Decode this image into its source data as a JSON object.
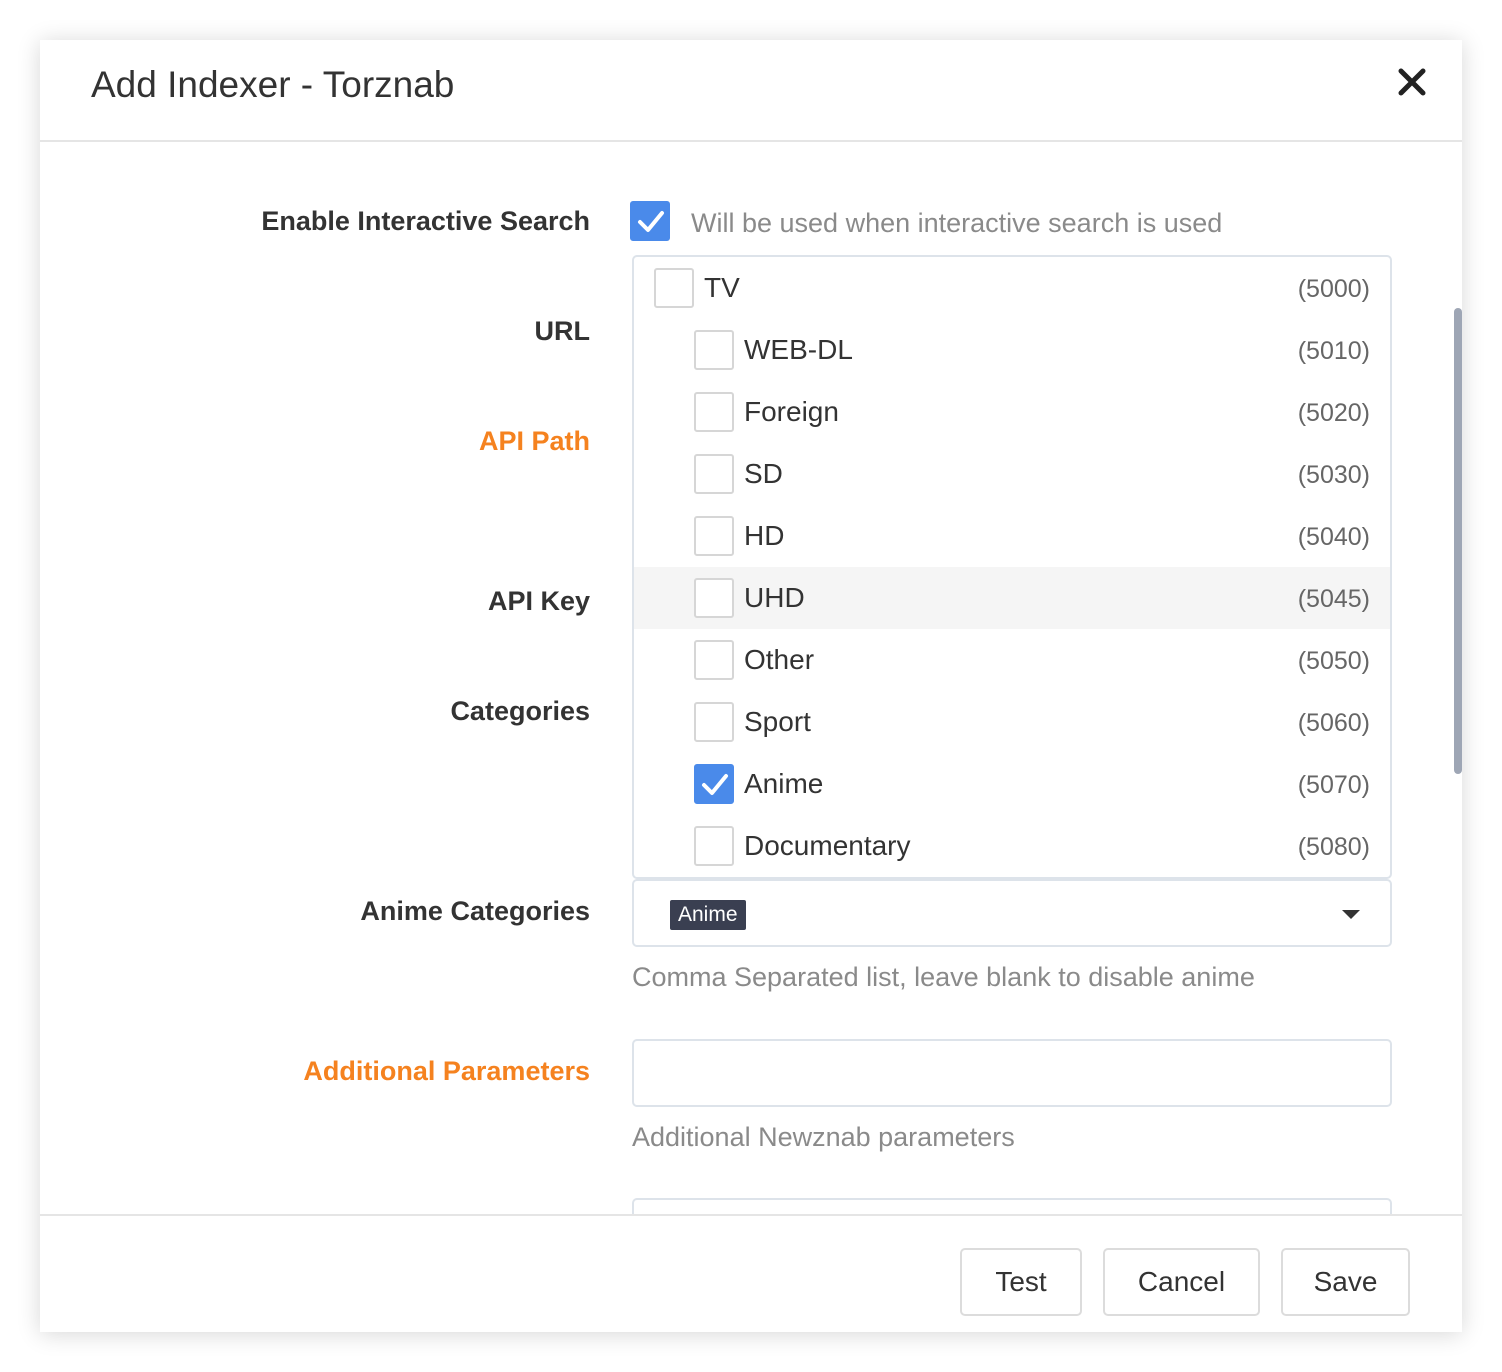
{
  "modal": {
    "title": "Add Indexer - Torznab",
    "close_icon": "close-icon"
  },
  "form": {
    "enable_interactive_search": {
      "label": "Enable Interactive Search",
      "checked": true,
      "help": "Will be used when interactive search is used"
    },
    "url": {
      "label": "URL"
    },
    "api_path": {
      "label": "API Path"
    },
    "api_key": {
      "label": "API Key"
    },
    "categories": {
      "label": "Categories",
      "items": [
        {
          "name": "TV",
          "id": "(5000)",
          "checked": false,
          "level": 0
        },
        {
          "name": "WEB-DL",
          "id": "(5010)",
          "checked": false,
          "level": 1
        },
        {
          "name": "Foreign",
          "id": "(5020)",
          "checked": false,
          "level": 1
        },
        {
          "name": "SD",
          "id": "(5030)",
          "checked": false,
          "level": 1
        },
        {
          "name": "HD",
          "id": "(5040)",
          "checked": false,
          "level": 1
        },
        {
          "name": "UHD",
          "id": "(5045)",
          "checked": false,
          "level": 1,
          "hovered": true
        },
        {
          "name": "Other",
          "id": "(5050)",
          "checked": false,
          "level": 1
        },
        {
          "name": "Sport",
          "id": "(5060)",
          "checked": false,
          "level": 1
        },
        {
          "name": "Anime",
          "id": "(5070)",
          "checked": true,
          "level": 1
        },
        {
          "name": "Documentary",
          "id": "(5080)",
          "checked": false,
          "level": 1
        }
      ]
    },
    "anime_categories": {
      "label": "Anime Categories",
      "selected_tag": "Anime",
      "help": "Comma Separated list, leave blank to disable anime"
    },
    "additional_parameters": {
      "label": "Additional Parameters",
      "value": "",
      "help": "Additional Newznab parameters"
    }
  },
  "footer": {
    "test_label": "Test",
    "cancel_label": "Cancel",
    "save_label": "Save"
  },
  "colors": {
    "accent": "#4a8aea",
    "warning": "#f5821f",
    "tag_bg": "#3a3f51"
  }
}
